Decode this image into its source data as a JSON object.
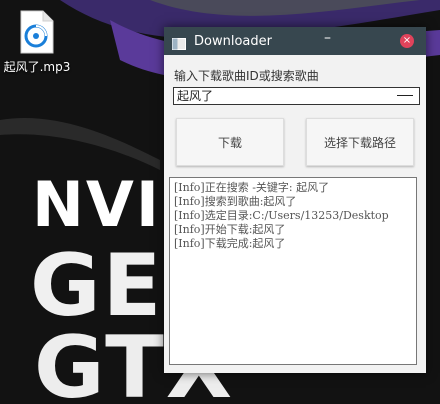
{
  "desktop": {
    "wallpaper_text": [
      "NVID",
      "GE",
      "GTX"
    ],
    "file_icon_label": "起风了.mp3"
  },
  "window": {
    "title": "Downloader",
    "minimize_symbol": "–",
    "close_symbol": "×",
    "prompt": "输入下载歌曲ID或搜索歌曲",
    "search_value": "起风了",
    "download_button": "下载",
    "choose_path_button": "选择下载路径",
    "log_lines": [
      "[Info]正在搜索 -关键字: 起风了",
      "[Info]搜索到歌曲:起风了",
      "[Info]选定目录:C:/Users/13253/Desktop",
      "[Info]开始下载:起风了",
      "[Info]下载完成:起风了"
    ]
  },
  "colors": {
    "titlebar": "#37474f",
    "close": "#e0435b",
    "wallpaper_purple": "#5a3a9a"
  }
}
